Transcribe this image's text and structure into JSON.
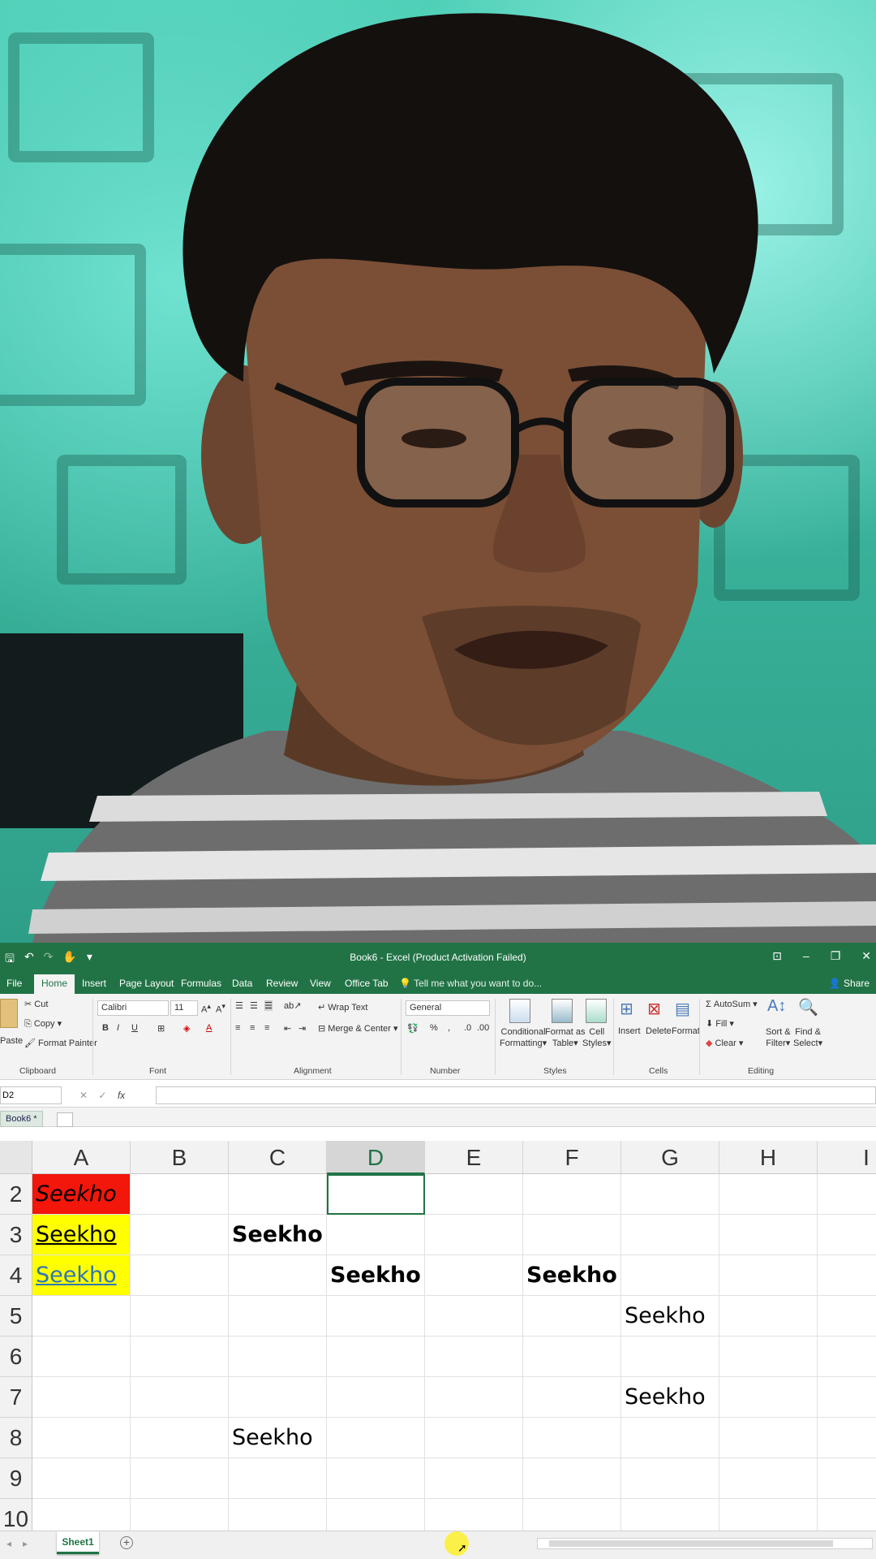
{
  "window": {
    "title": "Book6 - Excel (Product Activation Failed)",
    "share": "Share",
    "tell_me": "Tell me what you want to do..."
  },
  "ribbon_tabs": [
    "File",
    "Home",
    "Insert",
    "Page Layout",
    "Formulas",
    "Data",
    "Review",
    "View",
    "Office Tab"
  ],
  "ribbon": {
    "clipboard": {
      "paste": "Paste",
      "cut": "Cut",
      "copy": "Copy",
      "format_painter": "Format Painter",
      "label": "Clipboard"
    },
    "font": {
      "name": "Calibri",
      "size": "11",
      "bold": "B",
      "italic": "I",
      "underline": "U",
      "font_color": "A",
      "label": "Font"
    },
    "alignment": {
      "wrap_text": "Wrap Text",
      "merge_center": "Merge & Center",
      "label": "Alignment"
    },
    "number": {
      "format": "General",
      "percent": "%",
      "comma": ",",
      "label": "Number"
    },
    "styles": {
      "conditional_1": "Conditional",
      "conditional_2": "Formatting",
      "format_as_1": "Format as",
      "format_as_2": "Table",
      "cell_1": "Cell",
      "cell_2": "Styles",
      "label": "Styles"
    },
    "cells": {
      "insert": "Insert",
      "delete": "Delete",
      "format": "Format",
      "label": "Cells"
    },
    "editing": {
      "autosum": "AutoSum",
      "fill": "Fill",
      "clear": "Clear",
      "sort_1": "Sort &",
      "sort_2": "Filter",
      "find_1": "Find &",
      "find_2": "Select",
      "label": "Editing"
    }
  },
  "formula_bar": {
    "name_box": "D2",
    "fx": "fx",
    "cancel": "✕",
    "enter": "✓",
    "formula": ""
  },
  "workbook_tab": "Book6 *",
  "grid": {
    "columns": [
      "A",
      "B",
      "C",
      "D",
      "E",
      "F",
      "G",
      "H",
      "I"
    ],
    "selected_column": "D",
    "rows": [
      "2",
      "3",
      "4",
      "5",
      "6",
      "7",
      "8",
      "9",
      "10"
    ],
    "active_cell": "D2",
    "cells": {
      "A2": "Seekho",
      "A3": "Seekho",
      "A4": "Seekho",
      "C3": "Seekho",
      "D4": "Seekho",
      "F4": "Seekho",
      "G5": "Seekho",
      "G7": "Seekho",
      "C8": "Seekho"
    }
  },
  "sheets": {
    "active": "Sheet1",
    "add": "+"
  },
  "colors": {
    "excel_green": "#217346",
    "fill_red": "#f2160b",
    "fill_yellow": "#ffff00",
    "link_blue": "#2e75b6"
  }
}
